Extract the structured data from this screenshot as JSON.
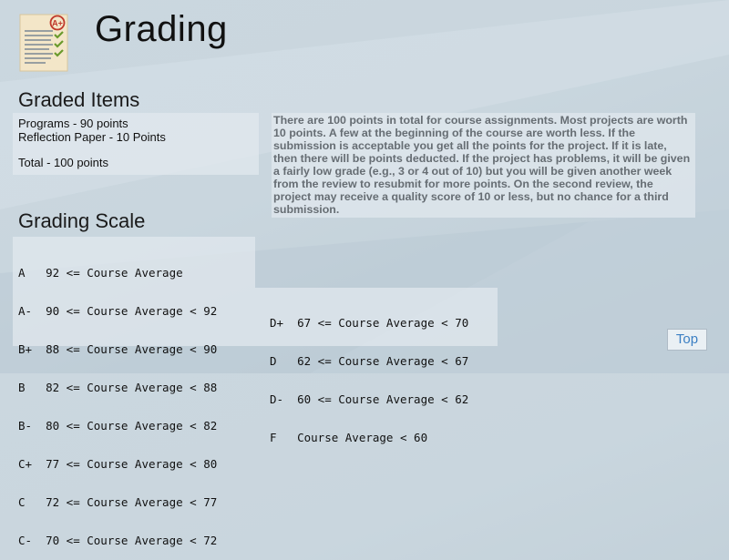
{
  "header": {
    "title": "Grading",
    "icon": "graded-paper-icon",
    "icon_badge": "A+"
  },
  "graded_items": {
    "heading": "Graded Items",
    "items": [
      "Programs - 90 points",
      "Reflection Paper - 10 Points"
    ],
    "total": "Total - 100 points"
  },
  "description": "There are 100 points in total for course assignments. Most projects are worth 10 points. A few at the beginning of the course are worth less. If the submission is acceptable you get all the points for the project. If it is late, then there will be points deducted. If the project has problems, it will be given a fairly low grade (e.g., 3 or 4 out of 10) but you will be given another week from the review to resubmit for more points. On the second review, the project may receive a quality score of 10 or less, but no chance for a third submission.",
  "grading_scale": {
    "heading": "Grading Scale",
    "left_rows": [
      "A   92 <= Course Average",
      "A-  90 <= Course Average < 92",
      "B+  88 <= Course Average < 90",
      "B   82 <= Course Average < 88",
      "B-  80 <= Course Average < 82",
      "C+  77 <= Course Average < 80",
      "C   72 <= Course Average < 77",
      "C-  70 <= Course Average < 72"
    ],
    "right_rows": [
      "D+  67 <= Course Average < 70",
      "D   62 <= Course Average < 67",
      "D-  60 <= Course Average < 62",
      "F   Course Average < 60"
    ]
  },
  "top_button": {
    "label": "Top"
  },
  "colors": {
    "background": "#c9d6de",
    "panel": "#e2e9ef",
    "description_text": "#666d73",
    "link": "#3b7fc3",
    "icon_check": "#6a9a2c",
    "icon_badge": "#c0392b"
  }
}
